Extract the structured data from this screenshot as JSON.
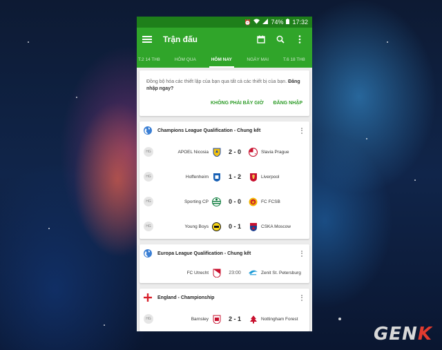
{
  "status_bar": {
    "battery": "74%",
    "time": "17:32"
  },
  "app_bar": {
    "title": "Trận đấu",
    "icons": [
      "menu-icon",
      "calendar-icon",
      "search-icon",
      "more-vert-icon"
    ]
  },
  "tabs": [
    {
      "label": "T.2 14 TH8",
      "active": false
    },
    {
      "label": "HÔM QUA",
      "active": false
    },
    {
      "label": "HÔM NAY",
      "active": true
    },
    {
      "label": "NGÀY MAI",
      "active": false
    },
    {
      "label": "T.6 18 TH8",
      "active": false
    }
  ],
  "sync_card": {
    "message": "Đồng bộ hóa các thiết lập của bạn qua tất cả các thiết bị của bạn.",
    "message_bold": "Đăng nhập ngay?",
    "not_now_label": "KHÔNG PHẢI BÂY GIỜ",
    "sign_in_label": "ĐĂNG NHẬP"
  },
  "competitions": [
    {
      "name": "Champions League Qualification - Chung kết",
      "icon": "globe-icon",
      "matches": [
        {
          "status": "HG",
          "home": "APOEL Nicosia",
          "score": "2 - 0",
          "away": "Slavia Prague"
        },
        {
          "status": "HG",
          "home": "Hoffenheim",
          "score": "1 - 2",
          "away": "Liverpool"
        },
        {
          "status": "HG",
          "home": "Sporting CP",
          "score": "0 - 0",
          "away": "FC FCSB"
        },
        {
          "status": "HG",
          "home": "Young Boys",
          "score": "0 - 1",
          "away": "CSKA Moscow"
        }
      ]
    },
    {
      "name": "Europa League Qualification - Chung kết",
      "icon": "globe-icon",
      "matches": [
        {
          "status": "",
          "home": "FC Utrecht",
          "score": "23:00",
          "away": "Zenit St. Petersburg"
        }
      ]
    },
    {
      "name": "England - Championship",
      "icon": "england-flag-icon",
      "matches": [
        {
          "status": "HG",
          "home": "Barnsley",
          "score": "2 - 1",
          "away": "Nottingham Forest"
        }
      ]
    }
  ],
  "watermark": {
    "text_main": "GEN",
    "text_accent": "K"
  },
  "colors": {
    "primary": "#30a52a",
    "status_bar": "#1e7f1a",
    "accent_text": "#2e9c28"
  }
}
